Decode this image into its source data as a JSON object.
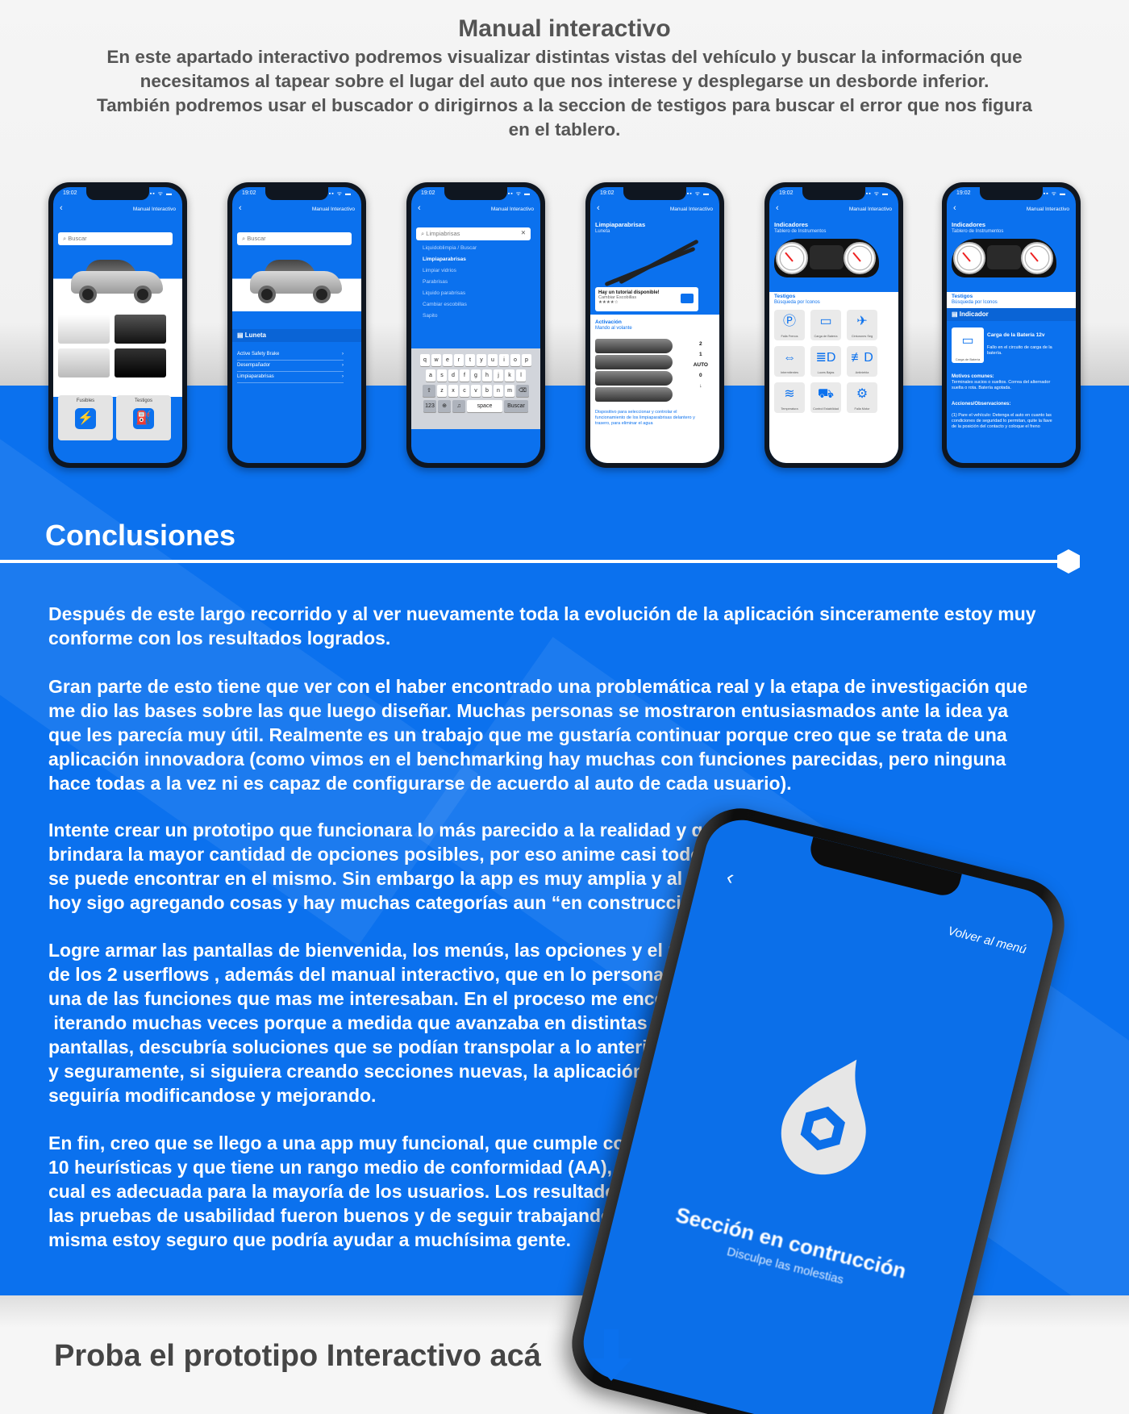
{
  "intro": {
    "title": "Manual interactivo",
    "l1": "En este apartado interactivo podremos visualizar distintas vistas del vehículo y buscar la información que",
    "l2": "necesitamos al tapear sobre el lugar del auto que nos interese y desplegarse un desborde inferior.",
    "l3": "También podremos usar el buscador o dirigirnos a la seccion de testigos para buscar el error que nos figura",
    "l4": "en el tablero."
  },
  "status": {
    "time": "19:02",
    "icons": "▪▪ ᯤ ▬"
  },
  "phone_common": {
    "header": "Manual Interactivo",
    "back": "‹"
  },
  "p1": {
    "search": "Buscar",
    "tile1": "Fusibles",
    "tile2": "Testigos"
  },
  "p2": {
    "search": "Buscar",
    "sheet": "Luneta",
    "items": [
      "Active Safety Brake",
      "Desempañador",
      "Limpiaparabrisas"
    ]
  },
  "p3": {
    "search": "Limpiabrisas",
    "suggestions": [
      "Liquidoblimpia / Buscar",
      "Limpiaparabrisas",
      "Limpiar vidrios",
      "Parabrisas",
      "Liquido parabrisas",
      "Cambiar escobillas",
      "Sapito"
    ],
    "keys_r1": [
      "q",
      "w",
      "e",
      "r",
      "t",
      "y",
      "u",
      "i",
      "o",
      "p"
    ],
    "keys_r2": [
      "a",
      "s",
      "d",
      "f",
      "g",
      "h",
      "j",
      "k",
      "l"
    ],
    "keys_r3": [
      "z",
      "x",
      "c",
      "v",
      "b",
      "n",
      "m"
    ],
    "space": "space",
    "buscar": "Buscar",
    "num": "123"
  },
  "p4": {
    "title": "Limpiaparabrisas",
    "subtitle": "Luneta",
    "tut_title": "Hay un tutorial disponible!",
    "tut_sub": "Cambiar Escobillas",
    "tut_stars": "★★★★☆",
    "act_title": "Activación",
    "act_sub": "Mando al volante",
    "nums": [
      "2",
      "1",
      "AUTO",
      "0",
      "↓"
    ],
    "desc": "Dispositivo para seleccionar y controlar el funcionamiento de los limpiaparabrisas delantero y trasero, para eliminar el agua"
  },
  "p5": {
    "title": "Indicadores",
    "subtitle": "Tablero de Instrumentos",
    "sec": "Testigos",
    "sec_sub": "Búsqueda por Iconos",
    "icons": [
      {
        "g": "Ⓟ",
        "l": "Falla Frenos"
      },
      {
        "g": "▭",
        "l": "Carga de Batería"
      },
      {
        "g": "✈",
        "l": "Cinturones Seg"
      },
      {
        "g": "⇔",
        "l": "Intermitentes"
      },
      {
        "g": "≣D",
        "l": "Luces Bajas"
      },
      {
        "g": "≢D",
        "l": "Antiniebla"
      },
      {
        "g": "≋",
        "l": "Temperatura"
      },
      {
        "g": "⛟",
        "l": "Control Estabilidad"
      },
      {
        "g": "⚙",
        "l": "Falla Motor"
      }
    ]
  },
  "p6": {
    "title": "Indicadores",
    "subtitle": "Tablero de Instrumentos",
    "sec": "Testigos",
    "sec_sub": "Búsqueda por Iconos",
    "ind": "Indicador",
    "box_label": "Carga de Batería",
    "ind_title": "Carga de la Batería 12v",
    "ind_desc": "Fallo en el circuito de carga de la batería.",
    "motivos": "Motivos comunes:",
    "motivos_text": "Terminales sucios o sueltos. Correa del alternador suelta o rota. Batería agotada.",
    "acciones": "Acciones/Observaciones:",
    "acciones_text": "(1) Pare el vehículo: Detenga el auto en cuanto las condiciones de seguridad lo permitan, quite la llave de la posición del contacto y coloque el freno"
  },
  "conclusions": {
    "title": "Conclusiones",
    "p1": [
      "Después de este largo recorrido y al ver nuevamente toda la evolución de la aplicación sinceramente estoy muy",
      "conforme con los resultados logrados."
    ],
    "p2": [
      "Gran parte de esto tiene que ver con el haber encontrado una problemática real y la etapa de investigación que",
      "me dio las bases sobre las que luego diseñar. Muchas personas se mostraron entusiasmados ante la idea ya",
      "que les parecía muy útil. Realmente es un trabajo que me gustaría continuar porque creo que se trata de una",
      "aplicación innovadora (como vimos en el benchmarking hay muchas con funciones parecidas, pero ninguna",
      "hace todas a la vez ni es capaz de configurarse de acuerdo al auto de cada usuario)."
    ],
    "p3": [
      "Intente crear un prototipo que funcionara lo más parecido a la realidad y que",
      "brindara la mayor cantidad de opciones posibles, por eso anime casi todo lo que",
      "se puede encontrar en el mismo. Sin embargo la app es muy amplia y al día de",
      "hoy sigo agregando cosas y hay muchas categorías aun “en construcción”."
    ],
    "p4": [
      "Logre armar las pantallas de bienvenida, los menús, las opciones y el recorrido",
      "de los 2 userflows , además del manual interactivo, que en lo personal era",
      "una de las funciones que mas me interesaban. En el proceso me encontré",
      " iterando muchas veces porque a medida que avanzaba en distintas",
      "pantallas, descubría soluciones que se podían transpolar a lo anterior",
      "y seguramente, si siguiera creando secciones nuevas, la aplicación",
      "seguiría modificandose y mejorando."
    ],
    "p5": [
      "En fin, creo que se llego a una app muy funcional, que cumple con las",
      "10 heurísticas y que tiene un rango medio de conformidad (AA), por lo",
      "cual es adecuada para la mayoría de los usuarios. Los resultados de",
      "las pruebas de usabilidad fueron buenos y de seguir trabajando en la",
      "misma estoy seguro que podría ayudar a muchísima gente."
    ]
  },
  "big_phone": {
    "back": "‹",
    "menu": "Volver al menú",
    "title": "Sección en contrucción",
    "subtitle": "Disculpe las molestias"
  },
  "cta": {
    "label": "Proba el prototipo Interactivo acá"
  },
  "colors": {
    "brand_blue": "#0b71ee",
    "text_gray": "#545454"
  }
}
